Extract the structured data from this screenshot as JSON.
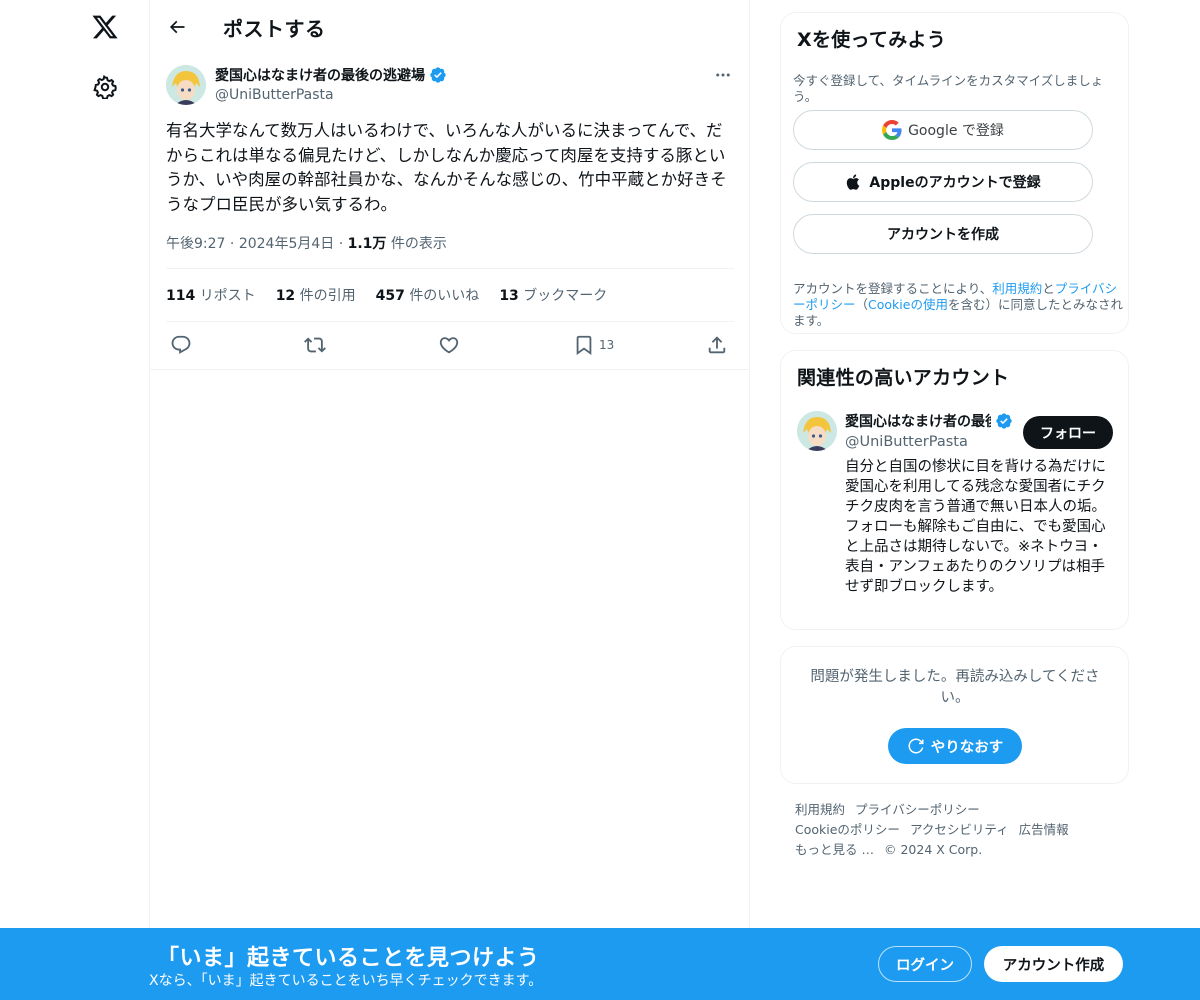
{
  "nav": {
    "logo_icon": "x-logo-icon",
    "settings_icon": "gear-icon"
  },
  "header": {
    "title": "ポストする"
  },
  "post": {
    "author_name": "愛国心はなまけ者の最後の逃避場",
    "author_handle": "@UniButterPasta",
    "text": "有名大学なんて数万人はいるわけで、いろんな人がいるに決まってんで、だからこれは単なる偏見たけど、しかしなんか慶応って肉屋を支持する豚というか、いや肉屋の幹部社員かな、なんかそんな感じの、竹中平蔵とか好きそうなプロ臣民が多い気するわ。",
    "time": "午後9:27",
    "date": "2024年5月4日",
    "views_count": "1.1万",
    "views_label": "件の表示",
    "stats": {
      "reposts_count": "114",
      "reposts_label": "リポスト",
      "quotes_count": "12",
      "quotes_label": "件の引用",
      "likes_count": "457",
      "likes_label": "件のいいね",
      "bookmarks_count": "13",
      "bookmarks_label": "ブックマーク"
    },
    "bookmark_action_count": "13"
  },
  "signup_card": {
    "title": "Xを使ってみよう",
    "subtitle": "今すぐ登録して、タイムラインをカスタマイズしましょう。",
    "google_label": "Google で登録",
    "apple_label": "Appleのアカウントで登録",
    "create_label": "アカウントを作成",
    "legal_1": "アカウントを登録することにより、",
    "legal_terms": "利用規約",
    "legal_2": "と",
    "legal_privacy": "プライバシーポリシー",
    "legal_3": "（",
    "legal_cookie": "Cookieの使用",
    "legal_4": "を含む）に同意したとみなされます。"
  },
  "related_card": {
    "title": "関連性の高いアカウント",
    "name": "愛国心はなまけ者の最後の逃避場",
    "handle": "@UniButterPasta",
    "follow_label": "フォロー",
    "bio": "自分と自国の惨状に目を背ける為だけに 愛国心を利用してる残念な愛国者にチクチク皮肉を言う普通で無い日本人の垢。　フォローも解除もご自由に、でも愛国心と上品さは期待しないで。※ネトウヨ・表自・アンフェあたりのクソリプは相手せず即ブロックします。"
  },
  "error_card": {
    "message": "問題が発生しました。再読み込みしてください。",
    "retry_label": "やりなおす"
  },
  "footer": {
    "terms": "利用規約",
    "privacy": "プライバシーポリシー",
    "cookie": "Cookieのポリシー",
    "accessibility": "アクセシビリティ",
    "ads": "広告情報",
    "more": "もっと見る …",
    "copyright": "© 2024 X Corp."
  },
  "bottom_bar": {
    "title": "「いま」起きていることを見つけよう",
    "subtitle": "Xなら、「いま」起きていることをいち早くチェックできます。",
    "login_label": "ログイン",
    "signup_label": "アカウント作成"
  },
  "colors": {
    "accent": "#1d9bf0",
    "text": "#0f1419",
    "muted": "#536471",
    "border": "#eff3f4"
  }
}
